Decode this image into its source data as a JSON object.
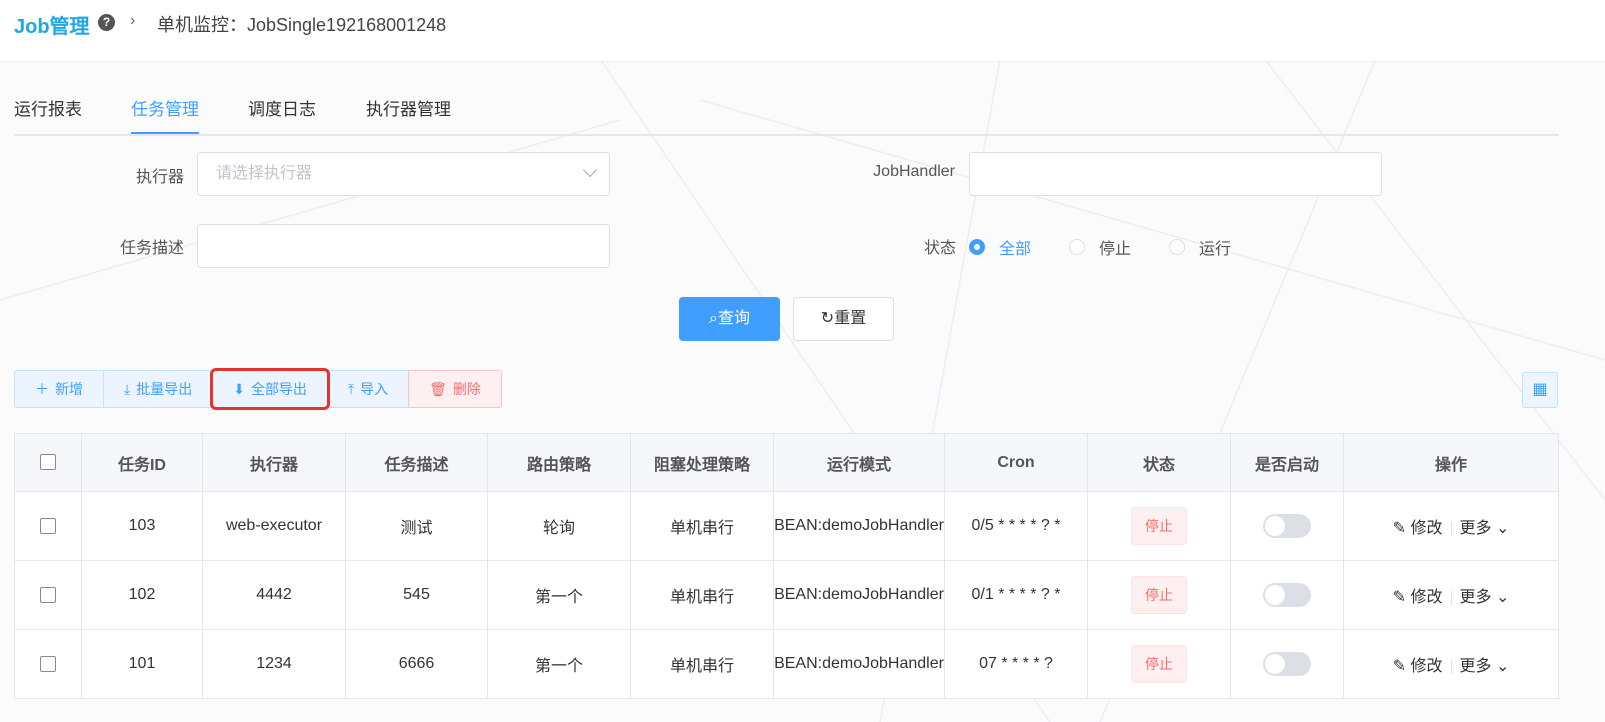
{
  "header": {
    "brand": "Job管理",
    "help_icon": "?",
    "chevron": "›",
    "breadcrumb": "单机监控：JobSingle192168001248"
  },
  "tabs": [
    "运行报表",
    "任务管理",
    "调度日志",
    "执行器管理"
  ],
  "active_tab": "任务管理",
  "form": {
    "executor_label": "执行器",
    "executor_placeholder": "请选择执行器",
    "jobhandler_label": "JobHandler",
    "jobhandler_value": "",
    "desc_label": "任务描述",
    "desc_value": "",
    "status_label": "状态",
    "status_options": [
      "全部",
      "停止",
      "运行"
    ],
    "status_selected": "全部",
    "search_button": "查询",
    "reset_button": "重置"
  },
  "toolbar": {
    "add": "新增",
    "batch_export": "批量导出",
    "export_all": "全部导出",
    "import": "导入",
    "delete": "删除"
  },
  "table": {
    "columns": [
      "任务ID",
      "执行器",
      "任务描述",
      "路由策略",
      "阻塞处理策略",
      "运行模式",
      "Cron",
      "状态",
      "是否启动",
      "操作"
    ],
    "rows": [
      {
        "id": "103",
        "executor": "web-executor",
        "desc": "测试",
        "route": "轮询",
        "block": "单机串行",
        "mode": "BEAN:demoJobHandler",
        "cron": "0/5 * * * * ? *",
        "status": "停止",
        "edit": "修改",
        "more": "更多"
      },
      {
        "id": "102",
        "executor": "4442",
        "desc": "545",
        "route": "第一个",
        "block": "单机串行",
        "mode": "BEAN:demoJobHandler",
        "cron": "0/1 * * * * ? *",
        "status": "停止",
        "edit": "修改",
        "more": "更多"
      },
      {
        "id": "101",
        "executor": "1234",
        "desc": "6666",
        "route": "第一个",
        "block": "单机串行",
        "mode": "BEAN:demoJobHandler",
        "cron": "07 * * * * ?",
        "status": "停止",
        "edit": "修改",
        "more": "更多"
      }
    ]
  },
  "colors": {
    "primary": "#409eff",
    "brand": "#1ea7e4",
    "danger": "#f56c6c",
    "highlight_box": "#e8332a"
  }
}
